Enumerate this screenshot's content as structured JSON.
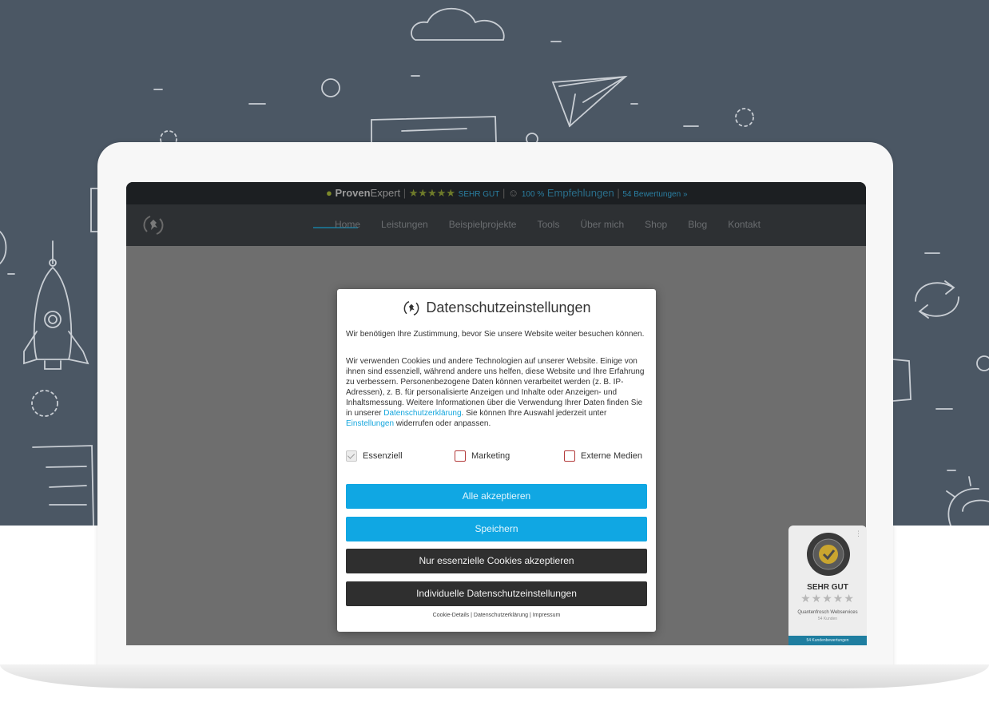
{
  "provenexpert_bar": {
    "brand_bold": "Proven",
    "brand_light": "Expert",
    "stars": "★★★★★",
    "rating": "SEHR GUT",
    "recommend": "100 %",
    "recommend_label": "Empfehlungen",
    "reviews": "54 Bewertungen »"
  },
  "nav": {
    "items": [
      "Home",
      "Leistungen",
      "Beispielprojekte",
      "Tools",
      "Über mich",
      "Shop",
      "Blog",
      "Kontakt"
    ]
  },
  "modal": {
    "title": "Datenschutzeinstellungen",
    "intro": "Wir benötigen Ihre Zustimmung, bevor Sie unsere Website weiter besuchen können.",
    "body_before_link1": "Wir verwenden Cookies und andere Technologien auf unserer Website. Einige von ihnen sind essenziell, während andere uns helfen, diese Website und Ihre Erfahrung zu verbessern. Personenbezogene Daten können verarbeitet werden (z. B. IP-Adressen), z. B. für personalisierte Anzeigen und Inhalte oder Anzeigen- und Inhaltsmessung. Weitere Informationen über die Verwendung Ihrer Daten finden Sie in unserer ",
    "link1": "Datenschutzerklärung",
    "body_between": ". Sie können Ihre Auswahl jederzeit unter ",
    "link2": "Einstellungen",
    "body_after": " widerrufen oder anpassen.",
    "checkboxes": [
      {
        "label": "Essenziell",
        "checked": true
      },
      {
        "label": "Marketing",
        "checked": false
      },
      {
        "label": "Externe Medien",
        "checked": false
      }
    ],
    "buttons": {
      "accept_all": "Alle akzeptieren",
      "save": "Speichern",
      "essential_only": "Nur essenzielle Cookies akzeptieren",
      "individual": "Individuelle Datenschutzeinstellungen"
    },
    "footer": {
      "cookie_details": "Cookie-Details",
      "sep": "|",
      "privacy": "Datenschutzerklärung",
      "imprint": "Impressum"
    }
  },
  "badge": {
    "seal_text": "Proven Expert",
    "rating": "SEHR GUT",
    "stars": "★★★★★",
    "company": "Quantenfrosch Webservices",
    "meta": "54 Kunden",
    "reviews": "54 Kundenbewertungen"
  },
  "colors": {
    "hero_bg": "#4b5764",
    "accent_blue": "#10a7e3",
    "dark_button": "#2f2f2f",
    "link": "#14a6dd",
    "checkbox_border": "#b23a3a"
  }
}
